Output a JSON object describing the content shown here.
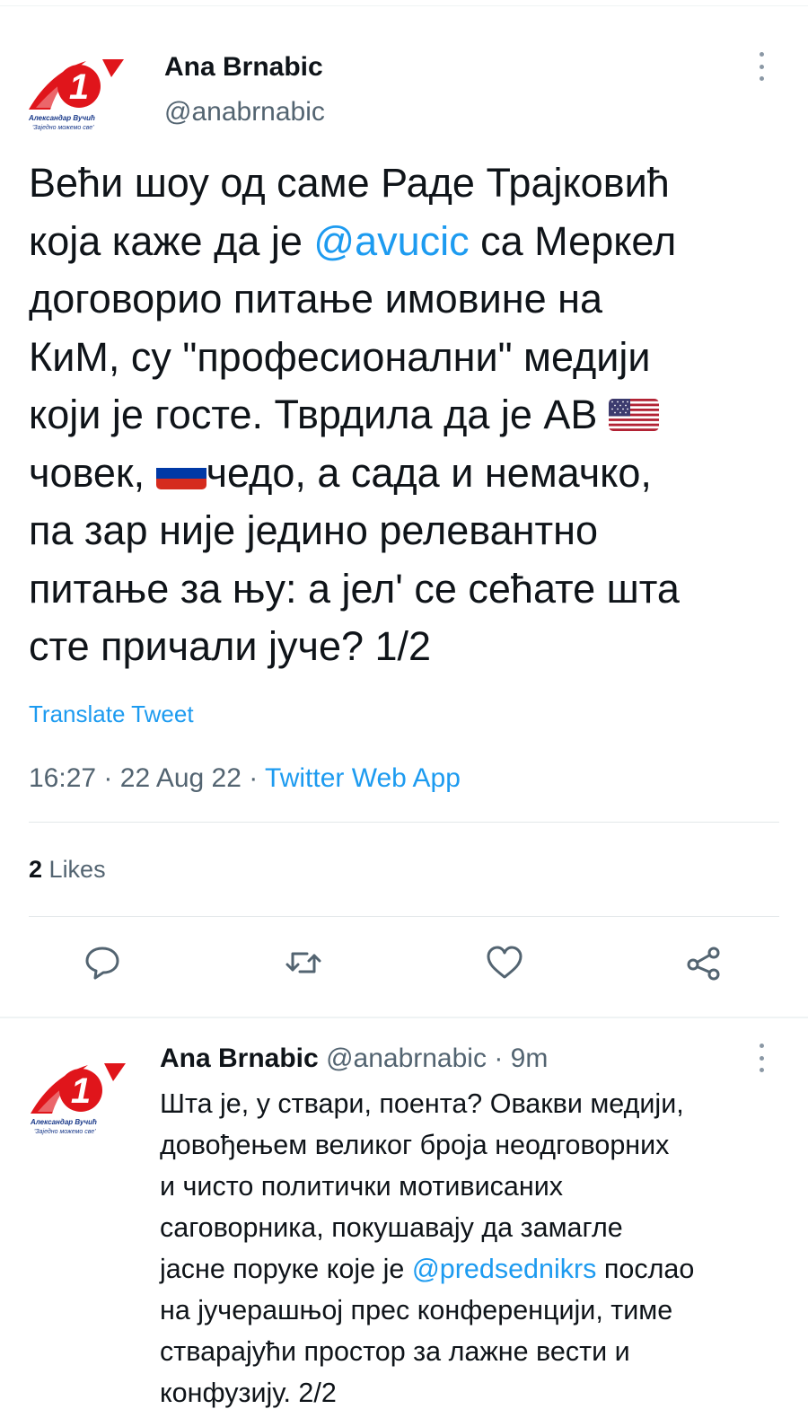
{
  "main_tweet": {
    "author_name": "Ana Brnabic",
    "author_handle": "@anabrnabic",
    "avatar": {
      "number": "1",
      "caption_line1": "Александар Вучић",
      "caption_line2": "'Заједно можемо све'"
    },
    "text": {
      "p1": "Већи шоу од саме Раде Трајковић\nкоја каже да је ",
      "mention": "@avucic",
      "p2": " са Меркел\nдоговорио питање имовине на\nКиМ, су \"професионални\" медији\nкоји је госте. Тврдила да је АВ ",
      "flag1": "flag-us",
      "p3": "\nчовек, ",
      "flag2": "flag-ru",
      "p4": "чедо, а сада и немачко,\nпа зар није једино релевантно\nпитање за њу: а јел' се сећате шта\nсте причали јуче? 1/2"
    },
    "translate_label": "Translate Tweet",
    "time": "16:27",
    "separator": "·",
    "date": "22 Aug 22",
    "app": "Twitter Web App",
    "likes_count": "2",
    "likes_label": "Likes",
    "actions": [
      "reply-icon",
      "retweet-icon",
      "like-icon",
      "share-icon"
    ]
  },
  "reply_tweet": {
    "author_name": "Ana Brnabic",
    "author_handle": "@anabrnabic",
    "separator": "·",
    "time": "9m",
    "avatar": {
      "number": "1",
      "caption_line1": "Александар Вучић",
      "caption_line2": "'Заједно можемо све'"
    },
    "text": {
      "p1": "Шта је, у ствари, поента? Овакви медији,\nдовођењем великог броја неодговорних\nи чисто политички мотивисаних\nсаговорника, покушавају да замагле\nјасне поруке које је ",
      "mention": "@predsednikrs",
      "p2": " послао\nна јучерашњој прес конференцији, тиме\nстварајући простор за лажне вести и\nконфузију. 2/2"
    }
  },
  "colors": {
    "accent": "#1d9bf0",
    "secondary_text": "#536471",
    "logo_red": "#e0151b"
  }
}
